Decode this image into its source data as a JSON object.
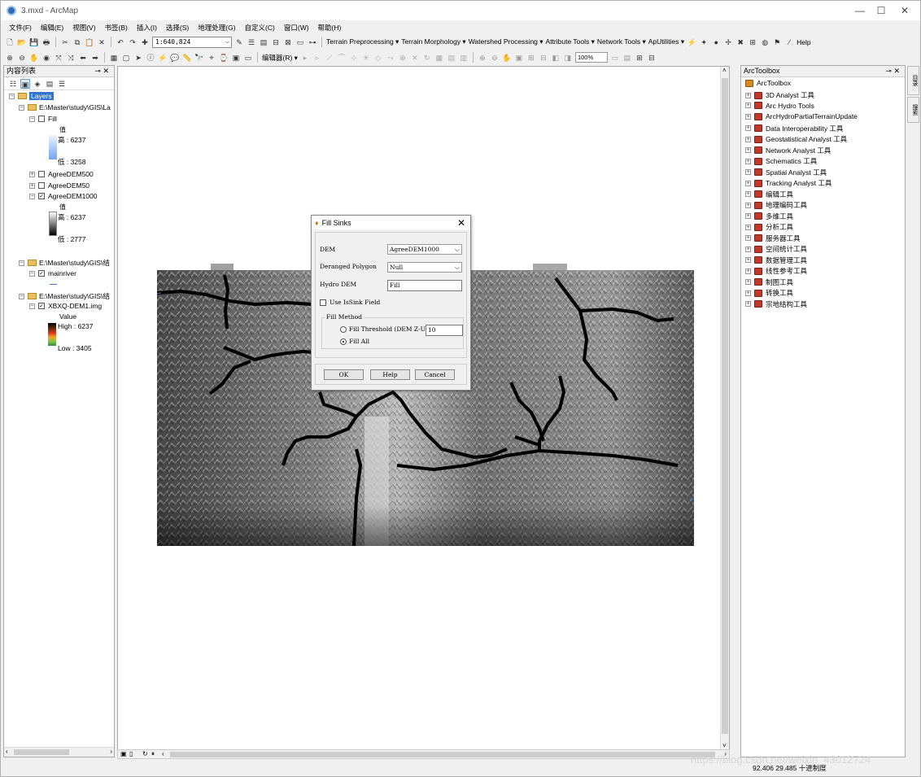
{
  "window": {
    "title": "3.mxd - ArcMap",
    "minimize": "—",
    "maximize": "☐",
    "close": "✕"
  },
  "menu": [
    "文件(F)",
    "编辑(E)",
    "视图(V)",
    "书签(B)",
    "插入(I)",
    "选择(S)",
    "地理处理(G)",
    "自定义(C)",
    "窗口(W)",
    "帮助(H)"
  ],
  "toolbar": {
    "scale": "1:640,824",
    "arc_hydro_menus": [
      "Terrain Preprocessing ▾",
      "Terrain Morphology ▾",
      "Watershed Processing ▾",
      "Attribute Tools ▾",
      "Network Tools ▾",
      "ApUtilities ▾"
    ],
    "help_label": "Help",
    "editor_label": "编辑器(R) ▾",
    "zoom": "100%"
  },
  "toc": {
    "title": "内容列表",
    "pin": "⊸ ✕",
    "layers_root": "Layers",
    "group1_path": "E:\\Master\\study\\GIS\\La",
    "fill_name": "Fill",
    "fill_value_label": "值",
    "fill_high": "高 : 6237",
    "fill_low": "低 : 3258",
    "layer_agree500": "AgreeDEM500",
    "layer_agree50": "AgreeDEM50",
    "layer_agree1000": "AgreeDEM1000",
    "agree1000_value_label": "值",
    "agree1000_high": "高 : 6237",
    "agree1000_low": "低 : 2777",
    "group2_path": "E:\\Master\\study\\GIS\\结",
    "mainriver": "mainriver",
    "group3_path": "E:\\Master\\study\\GIS\\结",
    "xbxq": "XBXQ-DEM1.img",
    "xbxq_value_label": "Value",
    "xbxq_high": "High : 6237",
    "xbxq_low": "Low : 3405"
  },
  "dialog": {
    "title": "Fill Sinks",
    "dem_label": "DEM",
    "dem_value": "AgreeDEM1000",
    "deranged_label": "Deranged Polygon",
    "deranged_value": "Null",
    "hydro_label": "Hydro DEM",
    "hydro_value": "Fill",
    "use_issink": "Use IsSink Field",
    "fill_method": "Fill Method",
    "fill_threshold": "Fill Threshold (DEM Z-Ur",
    "threshold_value": "10",
    "fill_all": "Fill All",
    "ok": "OK",
    "help": "Help",
    "cancel": "Cancel"
  },
  "toolbox": {
    "title": "ArcToolbox",
    "pin": "⊸ ✕",
    "root": "ArcToolbox",
    "items": [
      "3D Analyst 工具",
      "Arc Hydro Tools",
      "ArcHydroPartialTerrainUpdate",
      "Data Interoperability 工具",
      "Geostatistical Analyst 工具",
      "Network Analyst 工具",
      "Schematics 工具",
      "Spatial Analyst 工具",
      "Tracking Analyst 工具",
      "编辑工具",
      "地理编码工具",
      "多维工具",
      "分析工具",
      "服务器工具",
      "空间统计工具",
      "数据管理工具",
      "线性参考工具",
      "制图工具",
      "转换工具",
      "宗地结构工具"
    ]
  },
  "status": {
    "coords": "92.406  29.485 十进制度",
    "watermark": "https://blog.csdn.net/weixin_43012724"
  },
  "side_tabs": [
    "目录",
    "搜索"
  ]
}
